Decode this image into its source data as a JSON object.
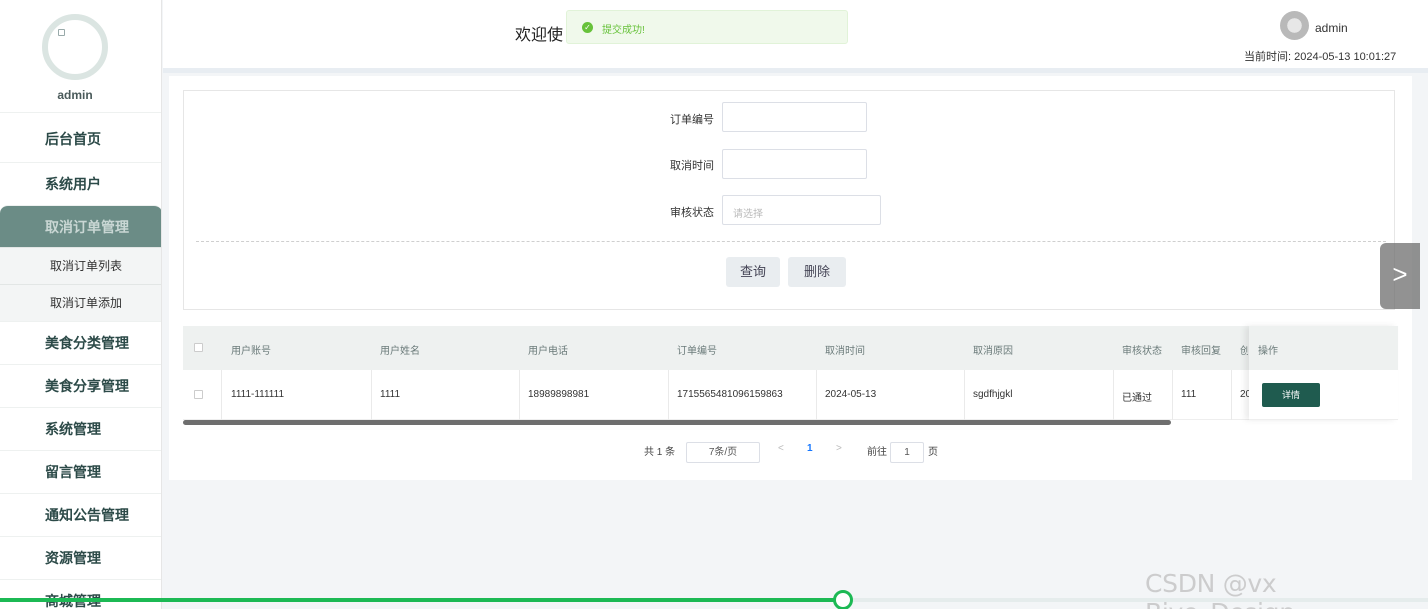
{
  "sidebar": {
    "username": "admin",
    "menu": {
      "home": "后台首页",
      "system_users": "系统用户",
      "cancel_order_mgmt": "取消订单管理",
      "cancel_order_list": "取消订单列表",
      "cancel_order_add": "取消订单添加",
      "food_category": "美食分类管理",
      "food_share": "美食分享管理",
      "system_mgmt": "系统管理",
      "message_mgmt": "留言管理",
      "notice_mgmt": "通知公告管理",
      "resource_mgmt": "资源管理",
      "mall_mgmt": "商城管理"
    }
  },
  "header": {
    "welcome": "欢迎使",
    "username": "admin",
    "time_label": "当前时间:",
    "time_value": "2024-05-13 10:01:27"
  },
  "toast": {
    "message": "提交成功!",
    "icon": "success-check-icon"
  },
  "search_form": {
    "order_no_label": "订单编号",
    "order_no_value": "",
    "cancel_time_label": "取消时间",
    "cancel_time_value": "",
    "review_status_label": "审核状态",
    "review_status_placeholder": "请选择",
    "query_button": "查询",
    "delete_button": "删除"
  },
  "table": {
    "headers": {
      "user_account": "用户账号",
      "user_name": "用户姓名",
      "user_phone": "用户电话",
      "order_no": "订单编号",
      "cancel_time": "取消时间",
      "cancel_reason": "取消原因",
      "review_status": "审核状态",
      "review_reply": "审核回复",
      "created_partial": "创",
      "action": "操作"
    },
    "rows": [
      {
        "user_account": "1111-111111",
        "user_name": "1111",
        "user_phone": "18989898981",
        "order_no": "1715565481096159863",
        "cancel_time": "2024-05-13",
        "cancel_reason": "sgdfhjgkl",
        "review_status": "已通过",
        "review_reply": "111",
        "created_partial": "20",
        "detail_button": "详情"
      }
    ]
  },
  "pagination": {
    "total_prefix": "共",
    "total_count": "1",
    "total_suffix": "条",
    "page_size": "7条/页",
    "prev": "<",
    "current_page": "1",
    "next": ">",
    "goto_label": "前往",
    "goto_value": "1",
    "goto_suffix": "页"
  },
  "overlay": {
    "next_arrow": ">",
    "watermark": "CSDN @vx Biye_Design",
    "video_progress_percent": 59,
    "accent_color": "#1cb954"
  }
}
